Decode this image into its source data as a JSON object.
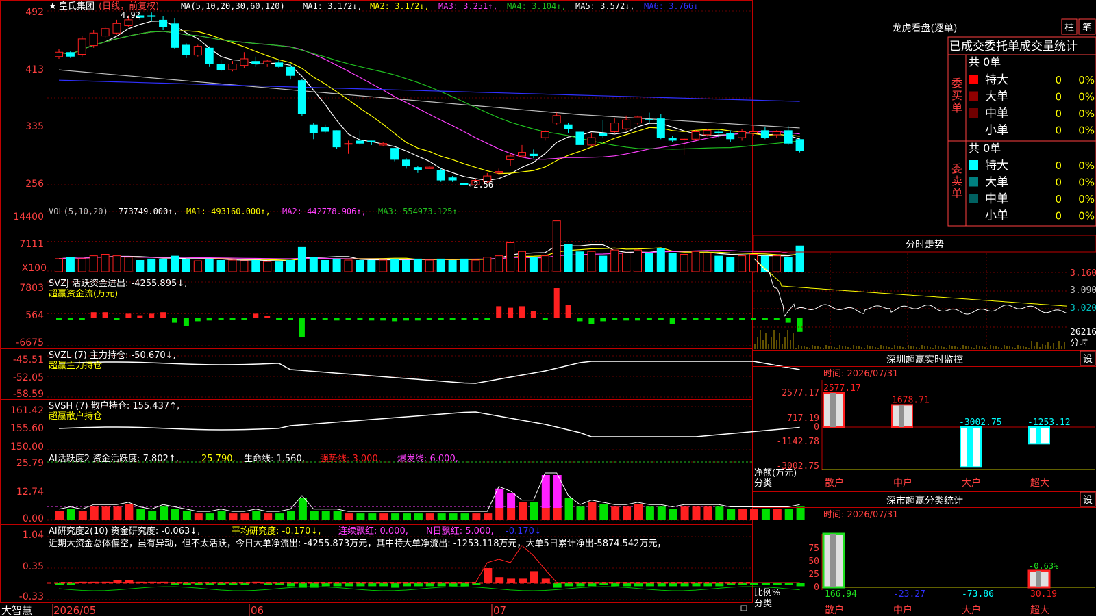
{
  "colors": {
    "up": "#ff2020",
    "down": "#00ffff",
    "grid": "#b00000",
    "axis": "#ff4040",
    "white": "#ffffff",
    "yellow": "#ffff00",
    "magenta": "#ff40ff",
    "green": "#20c020",
    "blue": "#3030ff",
    "gray": "#c0c0c0"
  },
  "main": {
    "stock_star": "★",
    "title": "皇氏集团",
    "mode": "(日线，前复权)",
    "ma_label": "MA(5,10,20,30,60,120)",
    "ma1": "MA1: 3.172↓,",
    "ma2": "MA2: 3.172↓,",
    "ma3": "MA3: 3.251↑,",
    "ma4": "MA4: 3.104↑,",
    "ma5": "MA5: 3.572↓,",
    "ma6": "MA6: 3.766↓",
    "high_mark": "4.92",
    "low_mark": "←2.56",
    "yticks": [
      "492",
      "413",
      "335",
      "256"
    ]
  },
  "vol": {
    "label": "VOL(5,10,20)",
    "value": "773749.000↑,",
    "ma1": "MA1: 493160.000↑,",
    "ma2": "MA2: 442778.906↑,",
    "ma3": "MA3: 554973.125↑",
    "yticks": [
      "14400",
      "7111",
      "X100"
    ]
  },
  "svzj": {
    "label": "SVZJ  活跃资金进出: -4255.895↓,",
    "sub": "超赢资金流(万元)",
    "yticks": [
      "7803",
      "564",
      "-6675"
    ]
  },
  "svzl": {
    "label": "SVZL (7) 主力持仓: -50.670↓,",
    "sub": "超赢主力持仓",
    "yticks": [
      "-45.51",
      "-52.05",
      "-58.59"
    ]
  },
  "svsh": {
    "label": "SVSH (7) 散户持仓: 155.437↑,",
    "sub": "超赢散户持仓",
    "yticks": [
      "161.42",
      "155.60",
      "150.00"
    ]
  },
  "ai1": {
    "label": "AI活跃度2 资金活跃度: 7.802↑,",
    "v2": "25.790,",
    "v3": "生命线: 1.560,",
    "v4": "强势线: 3.000,",
    "v5": "爆发线: 6.000,",
    "yticks": [
      "25.79",
      "12.74",
      "0.00"
    ]
  },
  "ai2": {
    "label": "AI研究度2(10) 资金研究度: -0.063↓,",
    "v2": "平均研究度: -0.170↓,",
    "v3": "连续飘红: 0.000,",
    "v4": "N日飘红: 5.000,",
    "v5": "-0.170↓",
    "comment": "近期大资金总体偏空，虽有异动，但不太活跃，今日大单净流出: -4255.873万元，其中特大单净流出: -1253.118万元，大单5日累计净出-5874.542万元，",
    "yticks": [
      "1.04",
      "0.35",
      "-0.33"
    ]
  },
  "xaxis": {
    "brand": "大智慧",
    "labels": [
      "2026/05",
      "06",
      "07"
    ]
  },
  "right": {
    "lhb_title": "龙虎看盘(逐单)",
    "tab1": "柱",
    "tab2": "笔",
    "stat_title": "已成交委托单成交量统计",
    "buy_side": "委买单",
    "sell_side": "委卖单",
    "buy_total": "共 0单",
    "sell_total": "共 0单",
    "buy_rows": [
      {
        "name": "特大",
        "v": "0",
        "p": "0%"
      },
      {
        "name": "大单",
        "v": "0",
        "p": "0%"
      },
      {
        "name": "中单",
        "v": "0",
        "p": "0%"
      },
      {
        "name": "小单",
        "v": "0",
        "p": "0%"
      }
    ],
    "sell_rows": [
      {
        "name": "特大",
        "v": "0",
        "p": "0%"
      },
      {
        "name": "大单",
        "v": "0",
        "p": "0%"
      },
      {
        "name": "中单",
        "v": "0",
        "p": "0%"
      },
      {
        "name": "小单",
        "v": "0",
        "p": "0%"
      }
    ],
    "intraday_title": "分时走势",
    "intraday_yticks": [
      "3.160",
      "3.090",
      "3.020"
    ],
    "intraday_vol": "26216",
    "intraday_vol_unit": "分时",
    "monitor_title": "深圳超赢实时监控",
    "set": "设",
    "time": "时间: 2026/07/31",
    "monitor_yticks": [
      "2577.17",
      "717.19",
      "0",
      "-1142.78",
      "-3002.75"
    ],
    "monitor_values": [
      "2577.17",
      "1678.71",
      "-3002.75",
      "-1253.12"
    ],
    "monitor_unit": "净额(万元)",
    "monitor_cat_label": "分类",
    "categories": [
      "散户",
      "中户",
      "大户",
      "超大"
    ],
    "class_title": "深市超赢分类统计",
    "class_time": "时间: 2026/07/31",
    "class_yticks": [
      "75",
      "50",
      "25",
      "0"
    ],
    "class_unit": "比例%",
    "class_cat_label": "分类",
    "class_values": [
      "166.94",
      "-23.27",
      "-73.86",
      "30.19"
    ],
    "class_top_label": "-0.63%"
  },
  "chart_data": {
    "type": "candlestick",
    "title": "皇氏集团",
    "x": [
      "2026/05",
      "06",
      "07"
    ],
    "ylim": [
      2.56,
      4.92
    ],
    "candles": [
      [
        4.3,
        4.36,
        4.4,
        4.27
      ],
      [
        4.36,
        4.3,
        4.38,
        4.28
      ],
      [
        4.33,
        4.54,
        4.58,
        4.3
      ],
      [
        4.45,
        4.62,
        4.66,
        4.42
      ],
      [
        4.58,
        4.68,
        4.71,
        4.55
      ],
      [
        4.62,
        4.75,
        4.8,
        4.6
      ],
      [
        4.72,
        4.8,
        4.86,
        4.7
      ],
      [
        4.86,
        4.83,
        4.92,
        4.8
      ],
      [
        4.86,
        4.84,
        4.9,
        4.78
      ],
      [
        4.8,
        4.7,
        4.85,
        4.66
      ],
      [
        4.75,
        4.42,
        4.82,
        4.4
      ],
      [
        4.46,
        4.32,
        4.48,
        4.28
      ],
      [
        4.32,
        4.44,
        4.46,
        4.3
      ],
      [
        4.42,
        4.2,
        4.44,
        4.16
      ],
      [
        4.2,
        4.12,
        4.26,
        4.1
      ],
      [
        4.12,
        4.2,
        4.24,
        4.1
      ],
      [
        4.18,
        4.27,
        4.36,
        4.14
      ],
      [
        4.24,
        4.2,
        4.3,
        4.16
      ],
      [
        4.2,
        4.24,
        4.26,
        4.16
      ],
      [
        4.22,
        4.16,
        4.26,
        4.14
      ],
      [
        4.16,
        4.04,
        4.2,
        3.99
      ],
      [
        3.98,
        3.52,
        4.0,
        3.49
      ],
      [
        3.38,
        3.26,
        3.4,
        3.18
      ],
      [
        3.34,
        3.28,
        3.38,
        3.26
      ],
      [
        3.3,
        3.07,
        3.3,
        3.05
      ],
      [
        3.12,
        3.12,
        3.16,
        2.98
      ],
      [
        3.16,
        3.12,
        3.3,
        3.1
      ],
      [
        3.16,
        3.14,
        3.16,
        3.1
      ],
      [
        3.1,
        3.12,
        3.14,
        3.08
      ],
      [
        3.06,
        2.9,
        3.06,
        2.88
      ],
      [
        2.9,
        2.82,
        2.92,
        2.78
      ],
      [
        2.8,
        2.76,
        2.82,
        2.72
      ],
      [
        2.78,
        2.8,
        2.82,
        2.78
      ],
      [
        2.76,
        2.62,
        2.78,
        2.6
      ],
      [
        2.66,
        2.62,
        2.68,
        2.6
      ],
      [
        2.58,
        2.56,
        2.6,
        2.54
      ],
      [
        2.56,
        2.62,
        2.64,
        2.56
      ],
      [
        2.6,
        2.68,
        2.72,
        2.58
      ],
      [
        2.72,
        2.74,
        2.78,
        2.7
      ],
      [
        2.9,
        2.95,
        2.98,
        2.82
      ],
      [
        2.95,
        3.0,
        3.1,
        2.94
      ],
      [
        2.98,
        2.95,
        3.04,
        2.92
      ],
      [
        3.2,
        3.28,
        3.3,
        3.16
      ],
      [
        3.4,
        3.5,
        3.54,
        3.38
      ],
      [
        3.38,
        3.32,
        3.4,
        3.26
      ],
      [
        3.28,
        3.1,
        3.3,
        3.08
      ],
      [
        3.1,
        3.2,
        3.26,
        3.08
      ],
      [
        3.26,
        3.22,
        3.44,
        3.2
      ],
      [
        3.28,
        3.4,
        3.46,
        3.26
      ],
      [
        3.32,
        3.44,
        3.5,
        3.3
      ],
      [
        3.4,
        3.48,
        3.5,
        3.38
      ],
      [
        3.45,
        3.44,
        3.54,
        3.4
      ],
      [
        3.46,
        3.2,
        3.52,
        3.18
      ],
      [
        3.2,
        3.16,
        3.22,
        3.14
      ],
      [
        3.18,
        3.18,
        3.2,
        2.96
      ],
      [
        3.18,
        3.28,
        3.3,
        3.16
      ],
      [
        3.24,
        3.3,
        3.32,
        3.22
      ],
      [
        3.28,
        3.26,
        3.32,
        3.2
      ],
      [
        3.26,
        3.18,
        3.3,
        3.14
      ],
      [
        3.2,
        3.28,
        3.32,
        3.16
      ],
      [
        3.26,
        3.28,
        3.36,
        3.22
      ],
      [
        3.3,
        3.2,
        3.34,
        3.18
      ],
      [
        3.24,
        3.28,
        3.3,
        3.2
      ],
      [
        3.3,
        3.12,
        3.36,
        3.1
      ],
      [
        3.18,
        3.02,
        3.2,
        3.0
      ]
    ]
  }
}
